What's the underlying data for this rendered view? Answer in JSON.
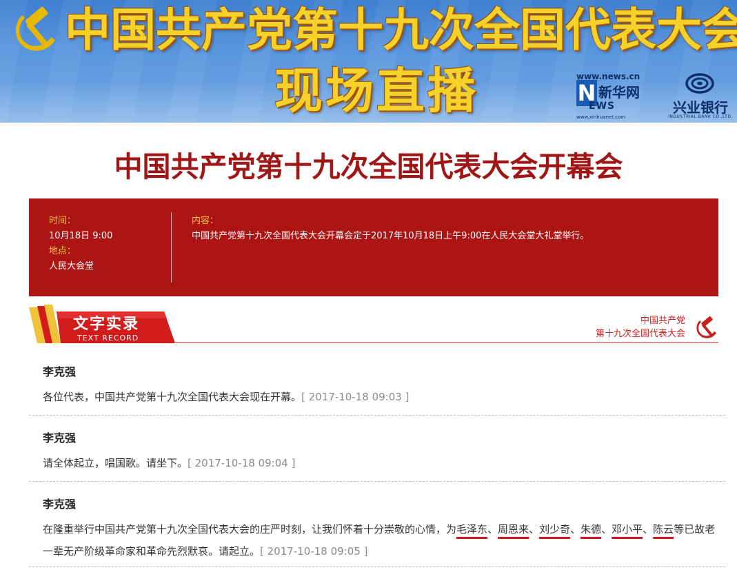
{
  "banner": {
    "title": "中国共产党第十九次全国代表大会",
    "subtitle": "现场直播",
    "xinhua": {
      "url": "www.news.cn",
      "letter": "N",
      "name": "新华网",
      "ews": "EWS",
      "url2": "www.xinhuanet.com"
    },
    "bank": {
      "name": "兴业银行",
      "en": "INDUSTRIAL BANK CO.,LTD."
    }
  },
  "page_title": "中国共产党第十九次全国代表大会开幕会",
  "info": {
    "time_label": "时间：",
    "time_value": "10月18日 9:00",
    "place_label": "地点：",
    "place_value": "人民大会堂",
    "content_label": "内容：",
    "content_value": "中国共产党第十九次全国代表大会开幕会定于2017年10月18日上午9:00在人民大会堂大礼堂举行。"
  },
  "section": {
    "title": "文字实录",
    "subtitle": "TEXT RECORD",
    "party_line1": "中国共产党",
    "party_line2": "第十九次全国代表大会"
  },
  "records": [
    {
      "speaker": "李克强",
      "text": "各位代表，中国共产党第十九次全国代表大会现在开幕。",
      "time": "[ 2017-10-18 09:03 ]"
    },
    {
      "speaker": "李克强",
      "text": "请全体起立，唱国歌。请坐下。",
      "time": "[ 2017-10-18 09:04 ]"
    },
    {
      "speaker": "李克强",
      "text_pre": "在隆重举行中国共产党第十九次全国代表大会的庄严时刻，让我们怀着十分崇敬的心情，为",
      "names": [
        "毛泽东",
        "周恩来",
        "刘少奇",
        "朱德",
        "邓小平",
        "陈云"
      ],
      "separator": "、",
      "text_post": "等已故老一辈无产阶级革命家和革命先烈默哀。请起立。",
      "time": "[ 2017-10-18 09:05 ]"
    }
  ],
  "colors": {
    "brand_red": "#ad1414",
    "title_red": "#a01616",
    "label_gold": "#f3c63d",
    "banner_gold": "#f4d22a",
    "underline_red": "#d01818"
  }
}
